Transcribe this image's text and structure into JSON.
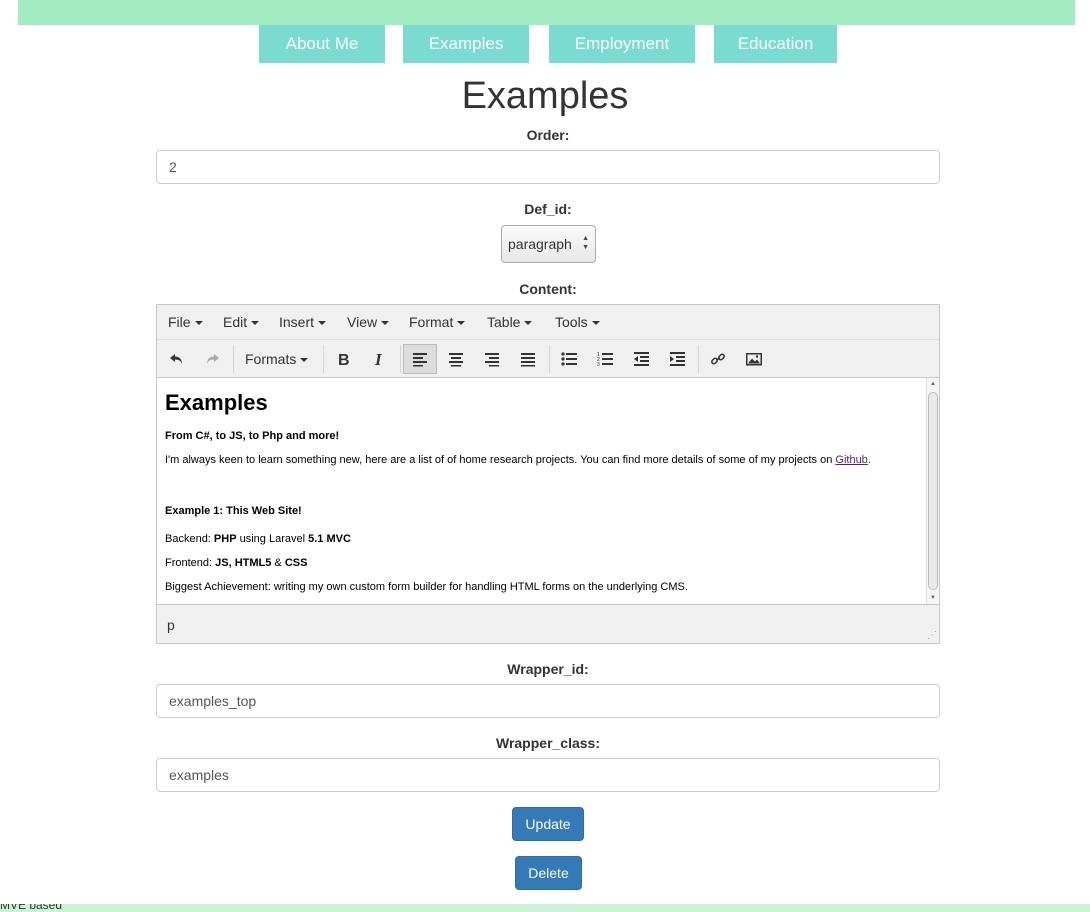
{
  "nav": {
    "items": [
      {
        "label": "About Me"
      },
      {
        "label": "Examples"
      },
      {
        "label": "Employment"
      },
      {
        "label": "Education"
      }
    ]
  },
  "page": {
    "title": "Examples"
  },
  "form": {
    "order": {
      "label": "Order:",
      "value": "2"
    },
    "def_id": {
      "label": "Def_id:",
      "value": "paragraph"
    },
    "content": {
      "label": "Content:"
    },
    "wrapper_id": {
      "label": "Wrapper_id:",
      "value": "examples_top"
    },
    "wrapper_class": {
      "label": "Wrapper_class:",
      "value": "examples"
    },
    "update_label": "Update",
    "delete_label": "Delete"
  },
  "editor": {
    "menu": [
      "File",
      "Edit",
      "Insert",
      "View",
      "Format",
      "Table",
      "Tools"
    ],
    "formats_label": "Formats",
    "status_path": "p",
    "content": {
      "heading": "Examples",
      "subheading": "From C#, to JS, to Php and more!",
      "intro": "I'm always keen to learn something new, here are a list of of home research projects.  You can find more details of some of my projects on ",
      "link_text": "Github",
      "intro_end": ".",
      "example_title": "Example 1: This Web Site!",
      "backend_label": "Backend: ",
      "backend_php": "PHP",
      "backend_using": " using Laravel ",
      "backend_mvc": "5.1 MVC",
      "frontend_label": "Frontend: ",
      "frontend_tech": "JS, HTML5",
      "frontend_amp": " & ",
      "frontend_css": "CSS",
      "achievement": "Biggest Achievement: writing my own custom form builder for handling HTML forms on the underlying CMS."
    }
  },
  "footer": {
    "text": "MVE based"
  }
}
